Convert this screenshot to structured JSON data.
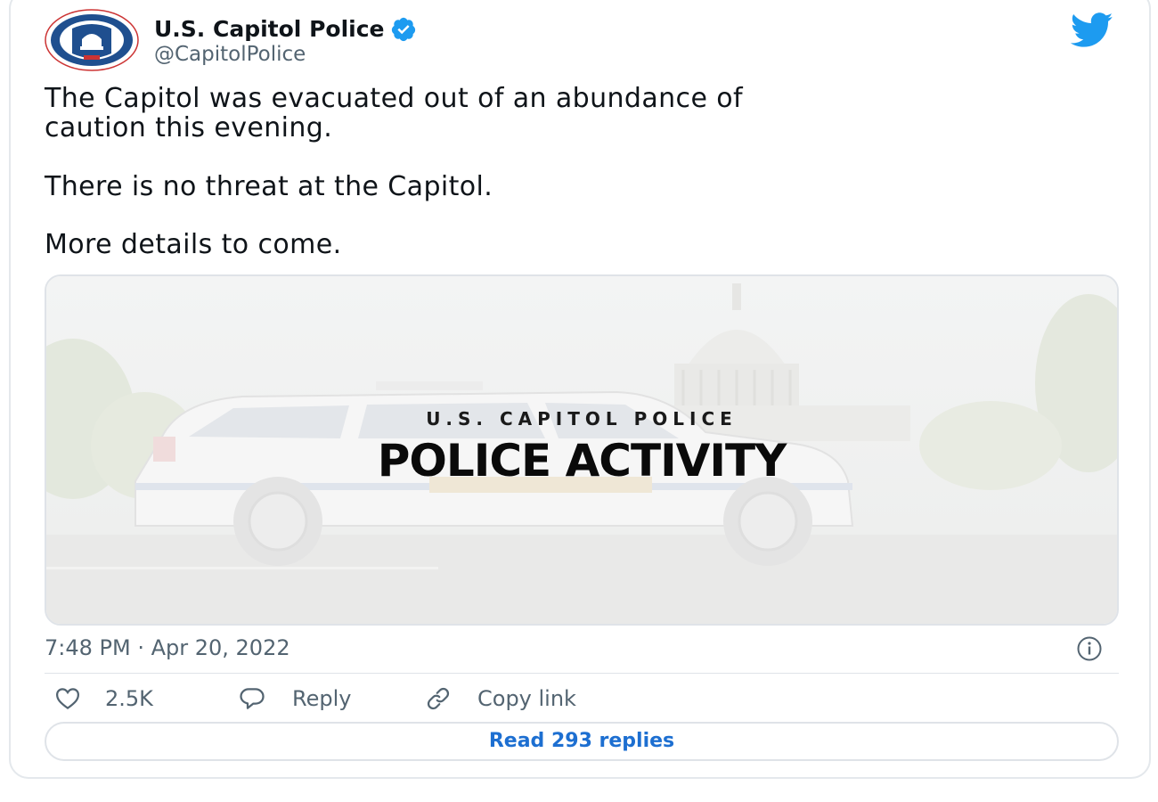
{
  "tweet": {
    "author": {
      "display_name": "U.S. Capitol Police",
      "handle": "@CapitolPolice",
      "verified": true,
      "avatar_icon": "capitol-police-badge-icon"
    },
    "text": {
      "line1": "The Capitol was evacuated out of an abundance of",
      "line2": "caution this evening.",
      "line3": "There is no threat at the Capitol.",
      "line4": "More details to come."
    },
    "media": {
      "subtitle": "U.S. CAPITOL POLICE",
      "title": "POLICE ACTIVITY"
    },
    "timestamp": "7:48 PM · Apr 20, 2022"
  },
  "actions": {
    "like_count": "2.5K",
    "reply_label": "Reply",
    "copy_link_label": "Copy link"
  },
  "footer": {
    "read_replies_label": "Read 293 replies"
  },
  "colors": {
    "twitter_blue": "#1d9bf0",
    "link_blue": "#1d6fd1",
    "secondary_text": "#536471"
  }
}
